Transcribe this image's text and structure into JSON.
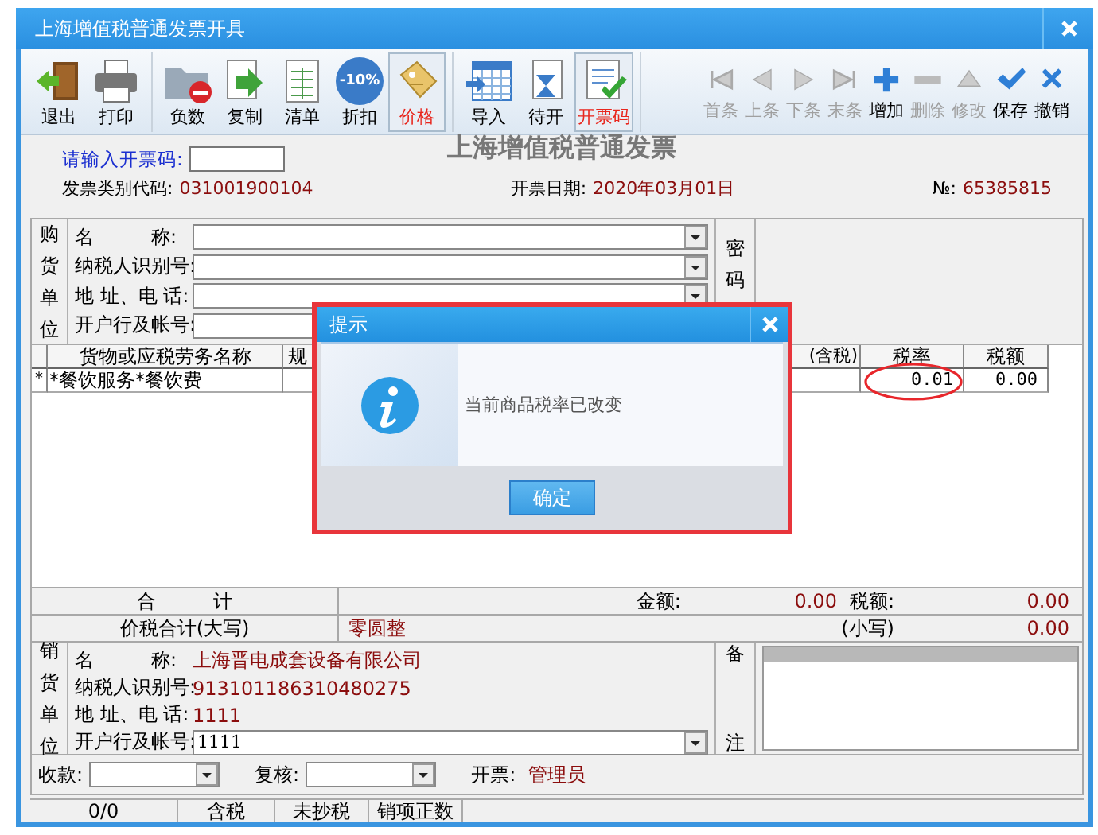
{
  "window": {
    "title": "上海增值税普通发票开具"
  },
  "toolbar": {
    "groups": [
      [
        {
          "label": "退出",
          "active": false,
          "disabled": false
        },
        {
          "label": "打印",
          "active": false,
          "disabled": false
        }
      ],
      [
        {
          "label": "负数",
          "active": false,
          "disabled": false
        },
        {
          "label": "复制",
          "active": false,
          "disabled": false
        },
        {
          "label": "清单",
          "active": false,
          "disabled": false
        },
        {
          "label": "折扣",
          "badge": "-10%",
          "active": false,
          "disabled": false
        },
        {
          "label": "价格",
          "active": true,
          "disabled": false
        }
      ],
      [
        {
          "label": "导入",
          "active": false,
          "disabled": false
        },
        {
          "label": "待开",
          "active": false,
          "disabled": false
        },
        {
          "label": "开票码",
          "active": true,
          "disabled": false
        }
      ],
      [
        {
          "label": "首条",
          "active": false,
          "disabled": true
        },
        {
          "label": "上条",
          "active": false,
          "disabled": true
        },
        {
          "label": "下条",
          "active": false,
          "disabled": true
        },
        {
          "label": "末条",
          "active": false,
          "disabled": true
        },
        {
          "label": "增加",
          "active": false,
          "disabled": false
        },
        {
          "label": "删除",
          "active": false,
          "disabled": true
        },
        {
          "label": "修改",
          "active": false,
          "disabled": true
        },
        {
          "label": "保存",
          "active": false,
          "disabled": false
        },
        {
          "label": "撤销",
          "active": false,
          "disabled": false
        }
      ]
    ]
  },
  "invoice": {
    "heading": "上海增值税普通发票",
    "code_prompt": "请输入开票码:",
    "type_code_label": "发票类别代码:",
    "type_code": "031001900104",
    "date_label": "开票日期:",
    "date": "2020年03月01日",
    "number_label": "№:",
    "number": "65385815"
  },
  "buyer": {
    "side_label": "购货单位",
    "cipher_label": "密码",
    "fields": [
      {
        "label": "名　　　称:"
      },
      {
        "label": "纳税人识别号:"
      },
      {
        "label": "地 址、电 话:"
      },
      {
        "label": "开户行及帐号:"
      }
    ]
  },
  "table": {
    "columns": [
      {
        "label": "货物或应税劳务名称"
      },
      {
        "label": "规"
      },
      {
        "label": "(含税)"
      },
      {
        "label": "税率"
      },
      {
        "label": "税额"
      }
    ],
    "rows": [
      {
        "marker": "*",
        "name": "*餐饮服务*餐饮费",
        "rate": "0.01",
        "tax": "0.00",
        "rate_circled": true
      }
    ]
  },
  "totals": {
    "total_label": "合　　　计",
    "amount_label": "金额:",
    "amount": "0.00",
    "tax_label": "税额:",
    "tax": "0.00",
    "words_label": "价税合计(大写)",
    "words": "零圆整",
    "figures_label": "(小写)",
    "figures": "0.00"
  },
  "seller": {
    "side_label": "销货单位",
    "remarks_label": "备注",
    "fields": [
      {
        "label": "名　　　称:",
        "value": "上海晋电成套设备有限公司",
        "kind": "text"
      },
      {
        "label": "纳税人识别号:",
        "value": "913101186310480275",
        "kind": "text"
      },
      {
        "label": "地 址、电 话:",
        "value": "1111",
        "kind": "text"
      },
      {
        "label": "开户行及帐号:",
        "value": "1111",
        "kind": "dropdown"
      }
    ]
  },
  "signers": [
    {
      "label": "收款:",
      "kind": "dropdown"
    },
    {
      "label": "复核:",
      "kind": "dropdown"
    },
    {
      "label": "开票:",
      "kind": "text",
      "value": "管理员"
    }
  ],
  "status_bar": [
    "0/0",
    "含税",
    "未抄税",
    "销项正数"
  ],
  "dialog": {
    "title": "提示",
    "message": "当前商品税率已改变",
    "button": "确定"
  }
}
